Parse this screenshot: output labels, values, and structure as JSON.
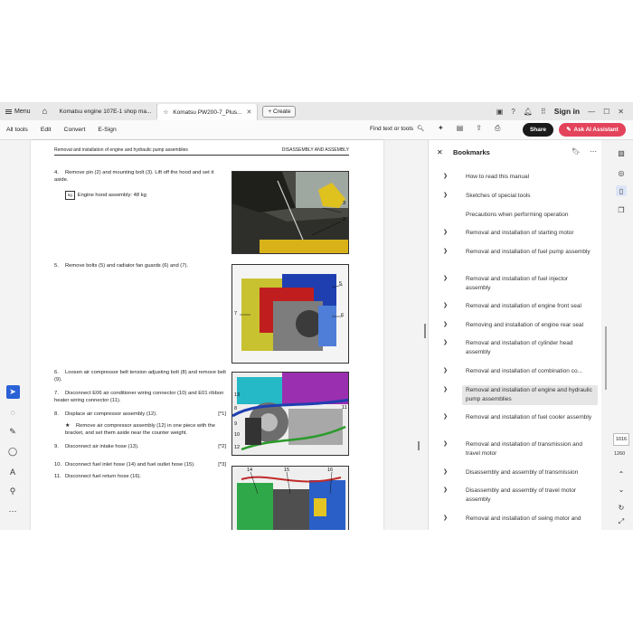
{
  "tabbar": {
    "menu_label": "Menu",
    "tabs": [
      {
        "label": "Komatsu engine 107E-1 shop ma..."
      },
      {
        "label": "Komatsu PW200-7_Plus..."
      }
    ],
    "create_label": "+ Create",
    "sign_in": "Sign in"
  },
  "toolbar": {
    "menu": [
      "All tools",
      "Edit",
      "Convert",
      "E-Sign"
    ],
    "find_label": "Find text or tools",
    "share_label": "Share",
    "ask_ai_label": "Ask AI Assistant"
  },
  "document": {
    "header_left": "Removal and installation of engine and hydraulic pump assemblies",
    "header_right": "DISASSEMBLY AND ASSEMBLY",
    "steps": [
      {
        "num": "4.",
        "text": "Remove pin (2) and mounting bolt (3). Lift off the hood and set it aside."
      },
      {
        "num": "",
        "text": "Engine hood assembly: 48 kg"
      },
      {
        "num": "5.",
        "text": "Remove bolts (5) and radiator fan guards (6) and (7)."
      },
      {
        "num": "6.",
        "text": "Loosen air compressor belt tension adjusting bolt (8) and remove belt (9)."
      },
      {
        "num": "7.",
        "text": "Disconnect E06 air conditioner wiring connector (10) and E01 ribbon heater wiring connector (11)."
      },
      {
        "num": "8.",
        "text": "Displace air compressor assembly (12).",
        "tag": "[*1]"
      },
      {
        "num": "★",
        "text": "Remove air compressor assembly (12) in one piece with the bracket, and set them aside near the counter weight."
      },
      {
        "num": "9.",
        "text": "Disconnect air intake hose (13).",
        "tag": "[*2]"
      },
      {
        "num": "10.",
        "text": "Disconnect fuel inlet hose (14) and fuel outlet hose (15).",
        "tag": "[*3]"
      },
      {
        "num": "11.",
        "text": "Disconnect fuel return hose (16)."
      }
    ],
    "weight_box": "kg",
    "callouts": {
      "fig1": [
        "3",
        "2"
      ],
      "fig2": [
        "5",
        "7",
        "6"
      ],
      "fig3": [
        "13",
        "8",
        "9",
        "10",
        "12",
        "11"
      ],
      "fig4": [
        "14",
        "15",
        "16"
      ]
    }
  },
  "bookmarks": {
    "title": "Bookmarks",
    "items": [
      {
        "label": "How to read this manual",
        "has_children": true
      },
      {
        "label": "Sketches of special tools",
        "has_children": true
      },
      {
        "label": "Precautions when performing operation",
        "has_children": false
      },
      {
        "label": "Removal and installation of starting motor",
        "has_children": true
      },
      {
        "label": "Removal and installation of fuel pump assembly",
        "has_children": true
      },
      {
        "label": "Removal and installation of fuel injector assembly",
        "has_children": true
      },
      {
        "label": "Removal and installation of engine front seal",
        "has_children": true
      },
      {
        "label": "Removing and installation of engine rear seal",
        "has_children": true
      },
      {
        "label": "Removal and installation of cylinder head assembly",
        "has_children": true
      },
      {
        "label": "Removal and installation of combination co...",
        "has_children": true
      },
      {
        "label": "Removal and installation of engine and hydraulic pump assemblies",
        "has_children": true,
        "selected": true
      },
      {
        "label": "Removal and installation of fuel cooler assembly",
        "has_children": true
      },
      {
        "label": "Removal and installation of transmission and travel motor",
        "has_children": true
      },
      {
        "label": "Disassembly and assembly of transmission",
        "has_children": true
      },
      {
        "label": "Disassembly and assembly of travel motor assembly",
        "has_children": true
      },
      {
        "label": "Removal and installation of swing motor and",
        "has_children": true
      }
    ]
  },
  "rail": {
    "page_current": "1016",
    "page_total": "1260"
  },
  "colors": {
    "accent_blue": "#2a62d6",
    "ai_button": "#e3445b",
    "share_button": "#1a1a1a"
  }
}
